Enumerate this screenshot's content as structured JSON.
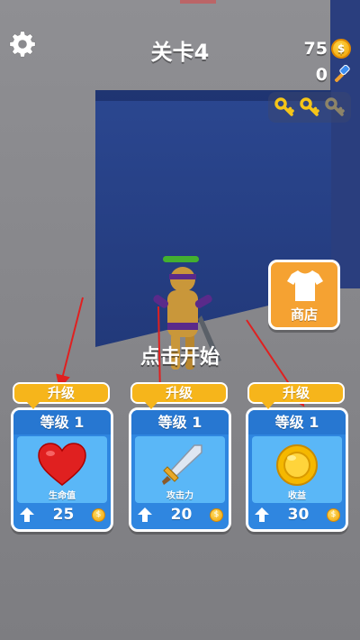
{
  "hud": {
    "level_title": "关卡4",
    "coins": "75",
    "hammers": "0",
    "keys_collected": 2,
    "keys_total": 3
  },
  "character": {
    "health_fraction": 1.0
  },
  "shop": {
    "label": "商店",
    "icon": "shirt-icon"
  },
  "start_text": "点击开始",
  "cards": [
    {
      "tag": "升级",
      "level": "等级 1",
      "name": "生命值",
      "cost": "25",
      "icon": "heart-icon",
      "accent": "#e02020"
    },
    {
      "tag": "升级",
      "level": "等级 1",
      "name": "攻击力",
      "cost": "20",
      "icon": "sword-icon",
      "accent": "#c8d6e8"
    },
    {
      "tag": "升级",
      "level": "等级 1",
      "name": "收益",
      "cost": "30",
      "icon": "coin-icon",
      "accent": "#f5b800"
    }
  ],
  "colors": {
    "card_blue": "#2f86e0",
    "tag_orange": "#f6b51b",
    "shop_orange": "#f5a232",
    "pit_blue": "#2b4790",
    "annotation_red": "#e02020"
  }
}
